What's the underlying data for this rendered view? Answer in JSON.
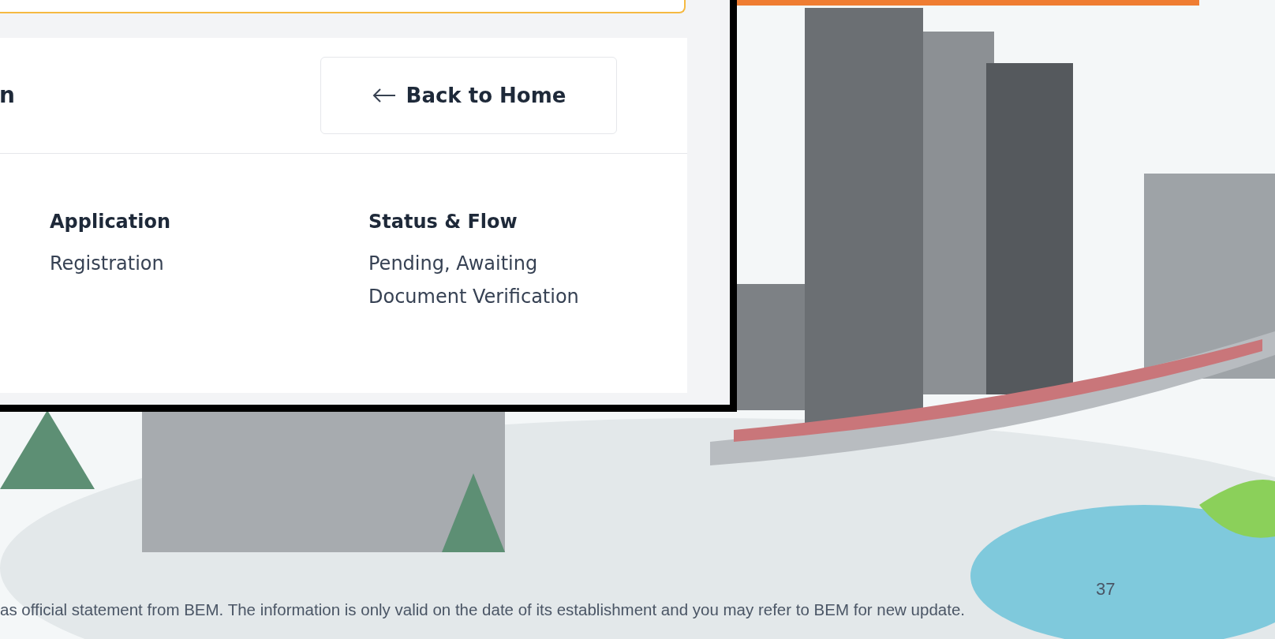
{
  "app": {
    "page_title": "n",
    "back_button": "Back to Home",
    "details": [
      {
        "label": "Application",
        "value": "Registration"
      },
      {
        "label": "Status & Flow",
        "value": "Pending, Awaiting Document Verification"
      }
    ]
  },
  "slide": {
    "disclaimer": "as official statement from BEM. The information is only valid on the date of its establishment and you may refer to BEM for new update.",
    "page_number": "37"
  }
}
